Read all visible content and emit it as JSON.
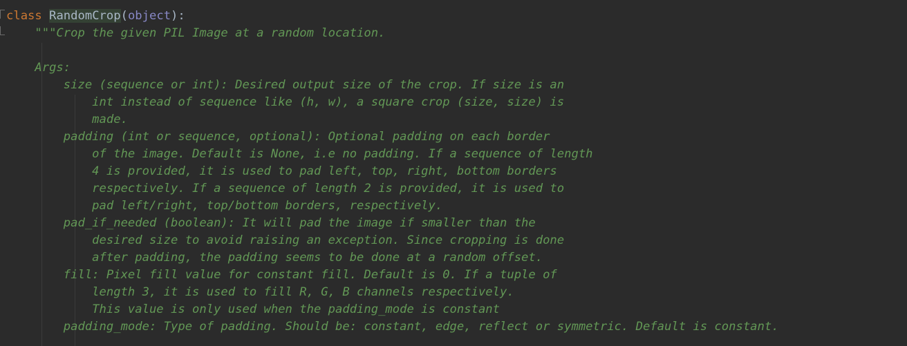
{
  "editor": {
    "keyword": "class",
    "class_name": "RandomCrop",
    "paren_open": "(",
    "base": "object",
    "paren_close": "):",
    "docstring": [
      "    \"\"\"Crop the given PIL Image at a random location.",
      "",
      "    Args:",
      "        size (sequence or int): Desired output size of the crop. If size is an",
      "            int instead of sequence like (h, w), a square crop (size, size) is",
      "            made.",
      "        padding (int or sequence, optional): Optional padding on each border",
      "            of the image. Default is None, i.e no padding. If a sequence of length",
      "            4 is provided, it is used to pad left, top, right, bottom borders",
      "            respectively. If a sequence of length 2 is provided, it is used to",
      "            pad left/right, top/bottom borders, respectively.",
      "        pad_if_needed (boolean): It will pad the image if smaller than the",
      "            desired size to avoid raising an exception. Since cropping is done",
      "            after padding, the padding seems to be done at a random offset.",
      "        fill: Pixel fill value for constant fill. Default is 0. If a tuple of",
      "            length 3, it is used to fill R, G, B channels respectively.",
      "            This value is only used when the padding_mode is constant",
      "        padding_mode: Type of padding. Should be: constant, edge, reflect or symmetric. Default is constant."
    ]
  },
  "colors": {
    "background": "#2b2b2b",
    "keyword": "#cc7832",
    "identifier": "#a9b7c6",
    "builtin": "#8888c6",
    "docstring": "#629755",
    "highlight": "#344134"
  }
}
